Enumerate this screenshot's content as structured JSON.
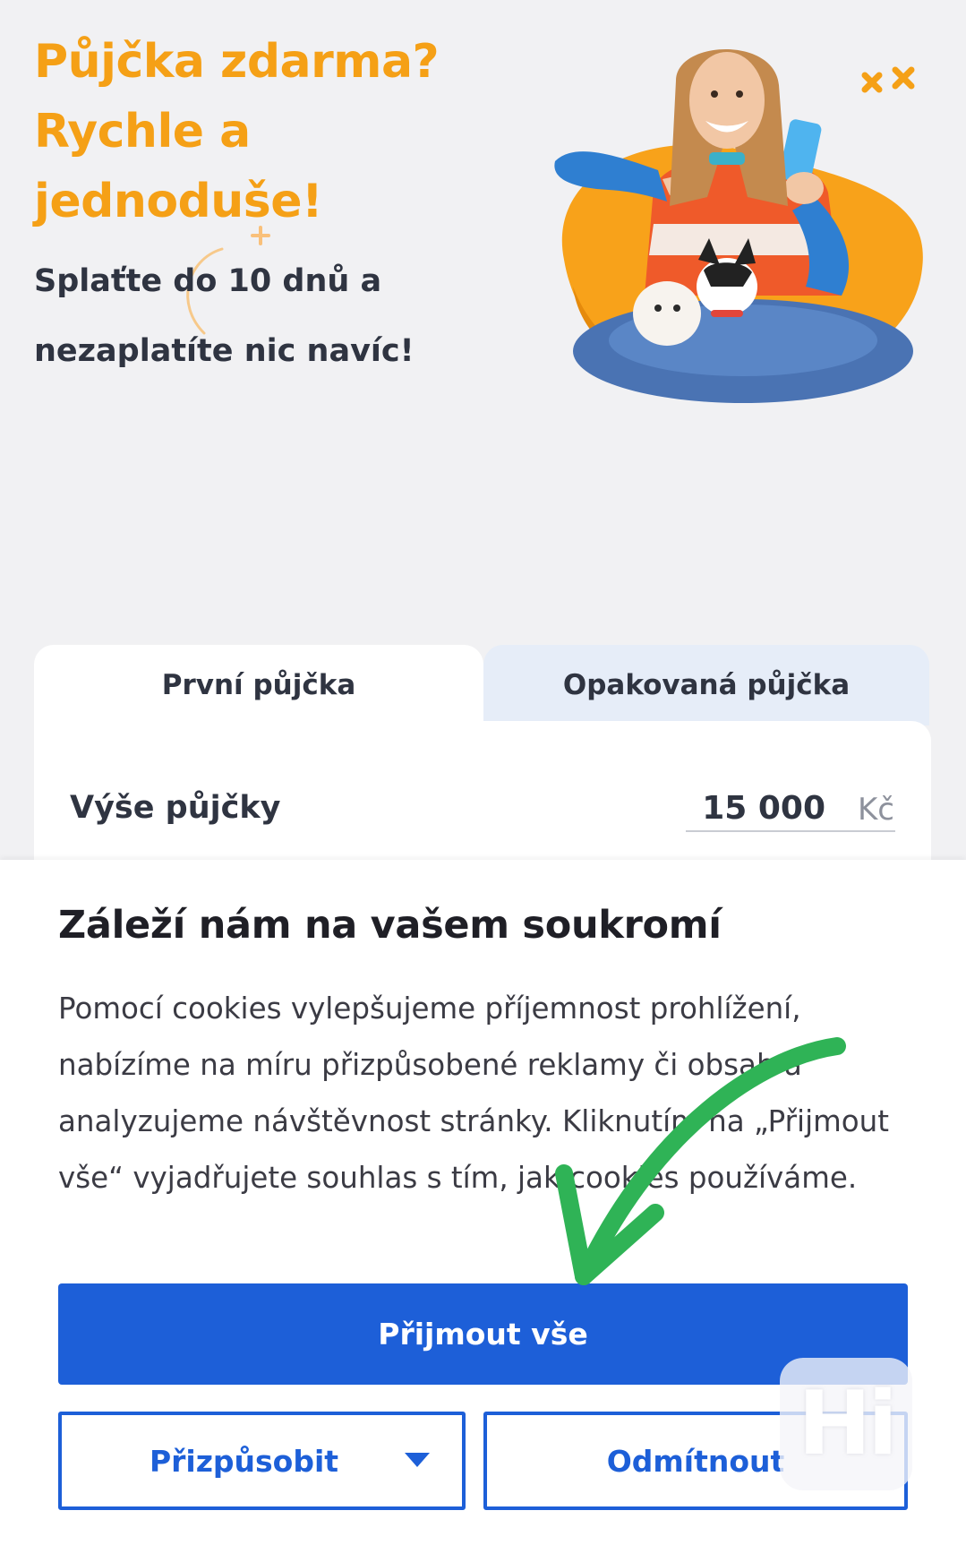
{
  "hero": {
    "title_lines": [
      "Půjčka zdarma?",
      "Rychle a",
      "jednoduše!"
    ],
    "subtitle_lines": [
      "Splaťte do 10 dnů a",
      "nezaplatíte nic navíc!"
    ]
  },
  "loan_card": {
    "tabs": [
      {
        "label": "První půjčka",
        "active": true
      },
      {
        "label": "Opakovaná půjčka",
        "active": false
      }
    ],
    "amount_label": "Výše půjčky",
    "amount_value": "15 000",
    "amount_unit": "Kč"
  },
  "cookie_dialog": {
    "title": "Záleží nám na vašem soukromí",
    "text": "Pomocí cookies vylepšujeme příjemnost prohlížení, nabízíme na míru přizpůsobené reklamy či obsah a analyzujeme návštěvnost stránky. Kliknutím na „Přijmout vše“ vyjadřujete souhlas s tím, jak cookies používáme.",
    "accept_label": "Přijmout vše",
    "customize_label": "Přizpůsobit",
    "reject_label": "Odmítnout"
  },
  "watermark": {
    "text": "Hi"
  },
  "colors": {
    "accent_orange": "#f5a016",
    "primary_blue": "#1d5fd8",
    "annotation_green": "#2fb356",
    "background": "#f1f1f3"
  }
}
